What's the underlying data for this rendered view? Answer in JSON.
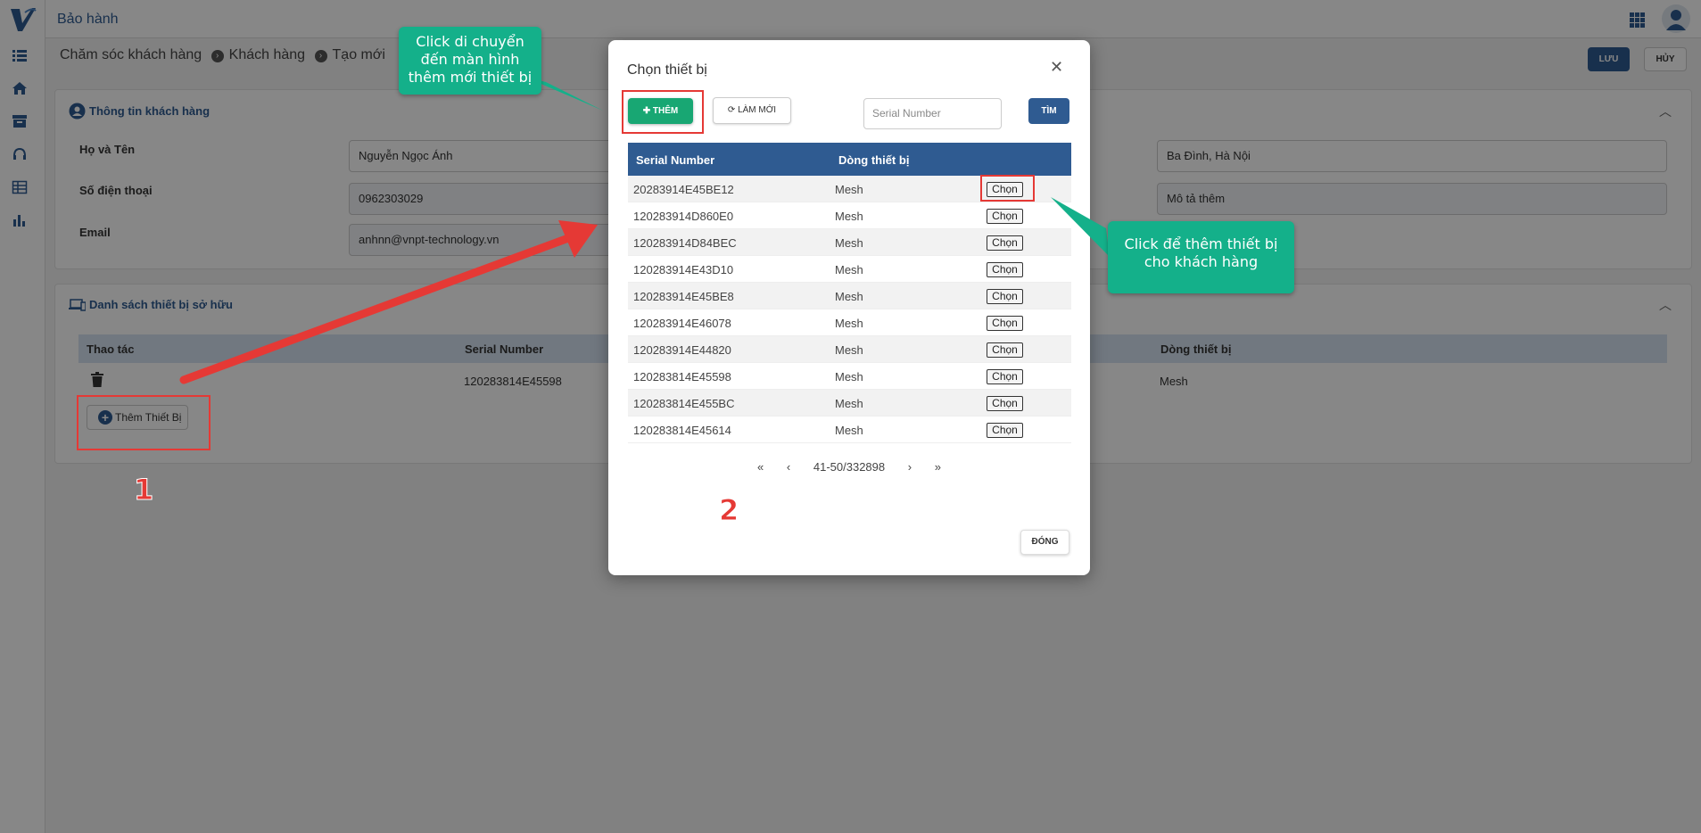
{
  "app": {
    "title": "Bảo hành"
  },
  "breadcrumb": [
    "Chăm sóc khách hàng",
    "Khách hàng",
    "Tạo mới"
  ],
  "actions": {
    "save": "LƯU",
    "cancel": "HỦY"
  },
  "customer": {
    "section_title": "Thông tin khách hàng",
    "name_label": "Họ và Tên",
    "name_value": "Nguyễn Ngọc Ánh",
    "phone_label": "Số điện thoại",
    "phone_value": "0962303029",
    "email_label": "Email",
    "email_value": "anhnn@vnpt-technology.vn",
    "address_value": "Ba Đình, Hà Nội",
    "description_value": "Mô tả thêm"
  },
  "devices": {
    "section_title": "Danh sách thiết bị sở hữu",
    "columns": [
      "Thao tác",
      "Serial Number",
      "Dòng thiết bị"
    ],
    "rows": [
      {
        "serial": "120283814E45598",
        "line": "Mesh"
      }
    ],
    "add_button": "Thêm Thiết Bị"
  },
  "modal": {
    "title": "Chọn thiết bị",
    "add_button": "THÊM",
    "refresh_button": "LÀM MỚI",
    "search_placeholder": "Serial Number",
    "search_button": "TÌM",
    "columns": [
      "Serial Number",
      "Dòng thiết bị"
    ],
    "pick_label": "Chọn",
    "rows": [
      {
        "serial": "20283914E45BE12",
        "line": "Mesh"
      },
      {
        "serial": "120283914D860E0",
        "line": "Mesh"
      },
      {
        "serial": "120283914D84BEC",
        "line": "Mesh"
      },
      {
        "serial": "120283914E43D10",
        "line": "Mesh"
      },
      {
        "serial": "120283914E45BE8",
        "line": "Mesh"
      },
      {
        "serial": "120283914E46078",
        "line": "Mesh"
      },
      {
        "serial": "120283914E44820",
        "line": "Mesh"
      },
      {
        "serial": "120283814E45598",
        "line": "Mesh"
      },
      {
        "serial": "120283814E455BC",
        "line": "Mesh"
      },
      {
        "serial": "120283814E45614",
        "line": "Mesh"
      }
    ],
    "pagination": {
      "first": "«",
      "prev": "‹",
      "range": "41-50/332898",
      "next": "›",
      "last": "»"
    },
    "close_button": "ĐÓNG"
  },
  "annotations": {
    "callout_add": "Click di chuyển đến màn hình thêm mới thiết bị",
    "callout_pick": "Click để thêm thiết bị cho khách hàng",
    "step1": "1",
    "step2": "2",
    "accent": "#e53935",
    "callout_color": "#14b08a"
  },
  "icons": [
    "logo-icon",
    "list-icon",
    "home-icon",
    "archive-icon",
    "headset-icon",
    "table-icon",
    "chart-icon",
    "apps-icon",
    "user-icon",
    "user-circle-icon",
    "devices-icon",
    "trash-icon",
    "plus-icon",
    "refresh-icon",
    "close-icon",
    "chevron-up-icon"
  ]
}
